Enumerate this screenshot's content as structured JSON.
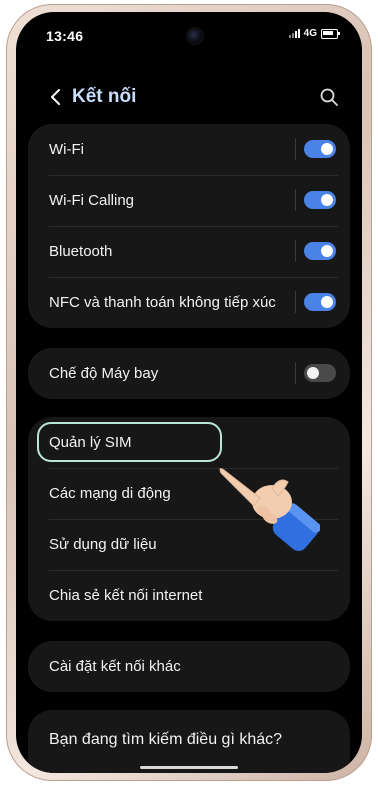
{
  "status_bar": {
    "time": "13:46",
    "network": "4G"
  },
  "header": {
    "title": "Kết nối",
    "back_icon": "chevron-left-icon",
    "search_icon": "search-icon"
  },
  "connectivity_card": {
    "items": [
      {
        "label": "Wi-Fi",
        "toggle": "on"
      },
      {
        "label": "Wi-Fi Calling",
        "toggle": "on"
      },
      {
        "label": "Bluetooth",
        "toggle": "on"
      },
      {
        "label": "NFC và thanh toán không tiếp xúc",
        "toggle": "on"
      }
    ]
  },
  "airplane_card": {
    "label": "Chế độ Máy bay",
    "toggle": "off"
  },
  "sim_card": {
    "items": [
      {
        "label": "Quản lý SIM",
        "highlighted": true
      },
      {
        "label": "Các mạng di động"
      },
      {
        "label": "Sử dụng dữ liệu"
      },
      {
        "label": "Chia sẻ kết nối internet"
      }
    ]
  },
  "more_card": {
    "label": "Cài đặt kết nối khác"
  },
  "search_suggestion": {
    "label": "Bạn đang tìm kiếm điều gì khác?"
  },
  "colors": {
    "accent": "#4b82e6",
    "title": "#c9ddff",
    "highlight": "#b8e6d4",
    "card": "#171717"
  }
}
